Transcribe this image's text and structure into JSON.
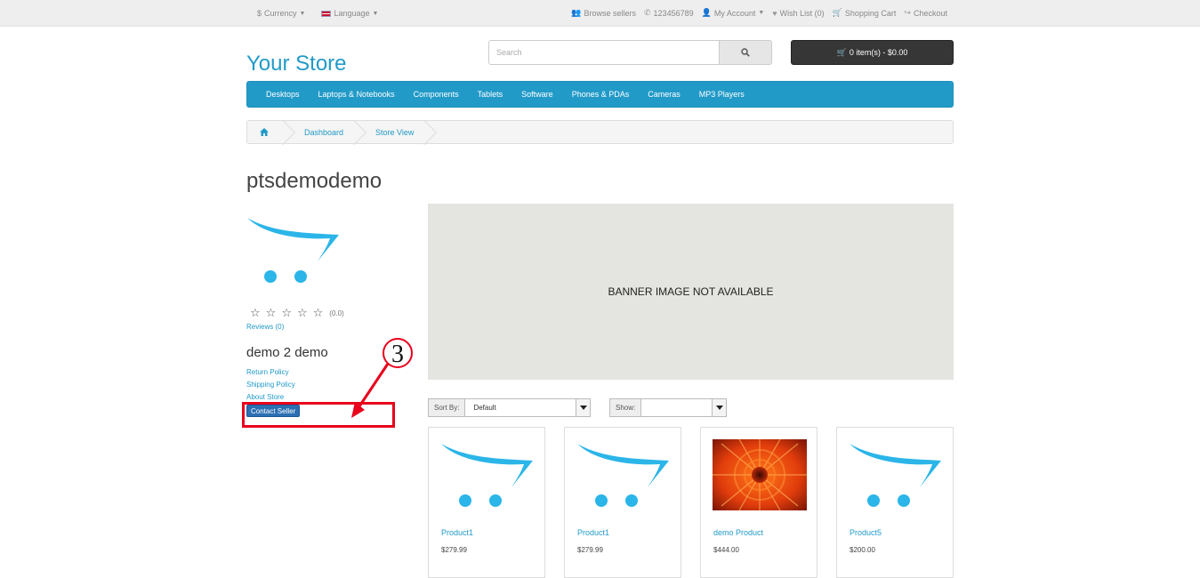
{
  "topbar": {
    "currency": "Currency",
    "currency_symbol": "$",
    "language": "Language",
    "browse_sellers": "Browse sellers",
    "phone": "123456789",
    "my_account": "My Account",
    "wish_list": "Wish List (0)",
    "shopping_cart": "Shopping Cart",
    "checkout": "Checkout"
  },
  "header": {
    "store_name": "Your Store",
    "search_placeholder": "Search",
    "cart_label": "0 item(s) - $0.00"
  },
  "menu": {
    "items": [
      "Desktops",
      "Laptops & Notebooks",
      "Components",
      "Tablets",
      "Software",
      "Phones & PDAs",
      "Cameras",
      "MP3 Players"
    ]
  },
  "breadcrumb": {
    "items": [
      "Dashboard",
      "Store View"
    ]
  },
  "seller": {
    "title": "ptsdemodemo",
    "rating_count": "(0.0)",
    "reviews": "Reviews (0)",
    "shop_name": "demo 2 demo",
    "links": [
      "Return Policy",
      "Shipping Policy",
      "About Store"
    ],
    "contact_button": "Contact Seller"
  },
  "annotation": {
    "number": "3",
    "color": "#e8001c"
  },
  "banner": {
    "text": "BANNER IMAGE NOT AVAILABLE"
  },
  "controls": {
    "sort_label": "Sort By:",
    "sort_value": "Default",
    "show_label": "Show:",
    "show_value": ""
  },
  "products": [
    {
      "name": "Product1",
      "price": "$279.99",
      "image": "opencart-cart-logo"
    },
    {
      "name": "Product1",
      "price": "$279.99",
      "image": "opencart-cart-logo"
    },
    {
      "name": "demo Product",
      "price": "$444.00",
      "image": "red-flower-photo"
    },
    {
      "name": "Product5",
      "price": "$200.00",
      "image": "opencart-cart-logo"
    }
  ],
  "colors": {
    "accent": "#229ac8",
    "cart_button": "#363636",
    "contact_button": "#2b6fb3"
  }
}
